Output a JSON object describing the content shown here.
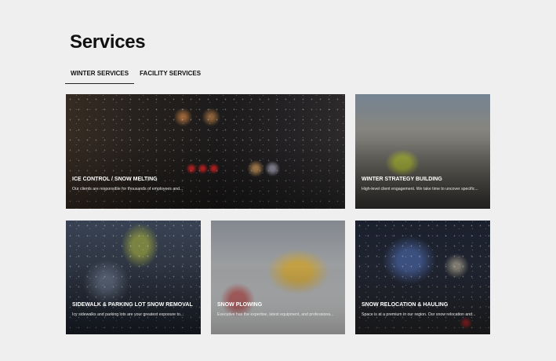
{
  "page": {
    "title": "Services"
  },
  "tabs": [
    {
      "label": "WINTER SERVICES",
      "active": true
    },
    {
      "label": "FACILITY SERVICES",
      "active": false
    }
  ],
  "cards": [
    {
      "title": "ICE CONTROL / SNOW MELTING",
      "description": "Our clients are responsible for thousands of employees and..."
    },
    {
      "title": "WINTER STRATEGY BUILDING",
      "description": "High-level client engagement. We take time to uncover specific..."
    },
    {
      "title": "SIDEWALK & PARKING LOT SNOW REMOVAL",
      "description": "Icy sidewalks and parking lots are your greatest exposure to..."
    },
    {
      "title": "SNOW PLOWING",
      "description": "Executive has the expertise, latest equipment, and professiona..."
    },
    {
      "title": "SNOW RELOCATION & HAULING",
      "description": "Space is at a premium in our region. Our snow relocation and..."
    }
  ]
}
